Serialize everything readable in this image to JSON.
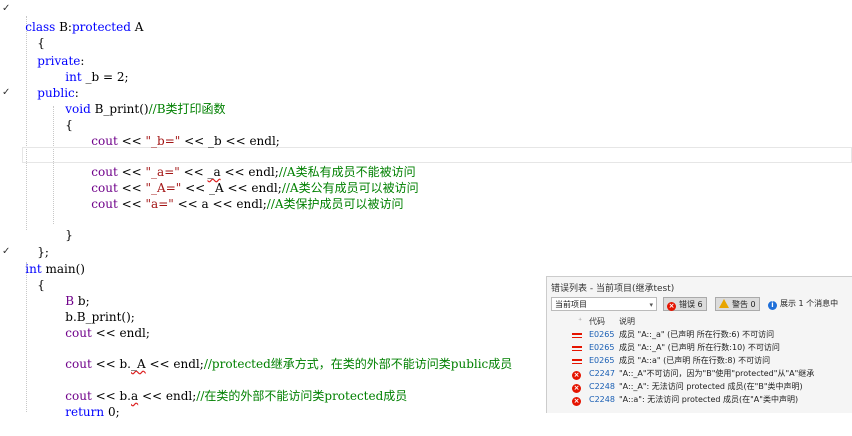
{
  "editor": {
    "lines": {
      "l1": {
        "kw1": "class",
        "rest": " B:",
        "kw2": "protected",
        "tail": " A"
      },
      "l2": {
        "t": "{"
      },
      "l3": {
        "kw": "private",
        "tail": ":"
      },
      "l4": {
        "kw": "int",
        "rest": " _b = 2;"
      },
      "l5": {
        "kw": "public",
        "tail": ":"
      },
      "l6": {
        "kw": "void",
        "rest": " B_print()",
        "cm": "//B类打印函数"
      },
      "l7": {
        "t": "{"
      },
      "l8": {
        "id": "cout",
        "o1": " << ",
        "s": "\"_b=\"",
        "o2": " << _b << endl;"
      },
      "l9": {
        "id": "cout",
        "o1": " << ",
        "s": "\"_a=\"",
        "o2": " << ",
        "err": "_a",
        "o3": " << endl;",
        "cm": "//A类私有成员不能被访问"
      },
      "l10": {
        "id": "cout",
        "o1": " << ",
        "s": "\"_A=\"",
        "o2": " << _A << endl;",
        "cm": "//A类公有成员可以被访问"
      },
      "l11": {
        "id": "cout",
        "o1": " << ",
        "s": "\"a=\"",
        "o2": " << a << endl;",
        "cm": "//A类保护成员可以被访问"
      },
      "l12": {
        "t": "}"
      },
      "l13": {
        "t": "};"
      },
      "l14": {
        "kw": "int",
        "rest": " main()"
      },
      "l15": {
        "t": "{"
      },
      "l16": {
        "id": "B",
        "rest": " b;"
      },
      "l17": {
        "t": "b.B_print();"
      },
      "l18": {
        "id": "cout",
        "o1": " << endl;"
      },
      "l19": {
        "id": "cout",
        "o1": " << b.",
        "err": "_A",
        "o2": " << endl;",
        "cm": "//protected继承方式，在类的外部不能访问类public成员"
      },
      "l20": {
        "id": "cout",
        "o1": " << b.",
        "err": "a",
        "o2": " << endl;",
        "cm": "//在类的外部不能访问类protected成员"
      },
      "l21": {
        "kw": "return",
        "rest": " 0;"
      }
    }
  },
  "error_list": {
    "title": "错误列表 - 当前项目(继承test)",
    "scope": "当前项目",
    "errors_label": "错误 6",
    "warnings_label": "警告 0",
    "messages_label": "展示 1 个消息中",
    "col_code": "代码",
    "col_desc": "说明",
    "rows": [
      {
        "code": "E0265",
        "desc": "成员 \"A::_a\" (已声明 所在行数:6) 不可访问"
      },
      {
        "code": "E0265",
        "desc": "成员 \"A::_A\" (已声明 所在行数:10) 不可访问"
      },
      {
        "code": "E0265",
        "desc": "成员 \"A::a\" (已声明 所在行数:8) 不可访问"
      },
      {
        "code": "C2247",
        "desc": "\"A::_A\"不可访问，因为\"B\"使用\"protected\"从\"A\"继承"
      },
      {
        "code": "C2248",
        "desc": "\"A::_A\": 无法访问 protected 成员(在\"B\"类中声明)"
      },
      {
        "code": "C2248",
        "desc": "\"A::a\": 无法访问 protected 成员(在\"A\"类中声明)"
      }
    ]
  },
  "colors": {
    "keyword": "#0000ff",
    "identifier": "#6f008a",
    "string": "#a31515",
    "comment": "#008000",
    "error": "#e51400"
  }
}
